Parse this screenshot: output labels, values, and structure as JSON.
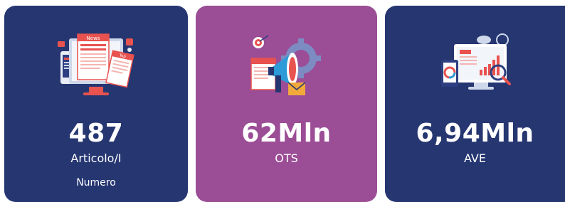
{
  "cards": [
    {
      "value": "487",
      "label": "Articolo/I",
      "sublabel": "Numero",
      "icon": "news-articles-icon"
    },
    {
      "value": "62Mln",
      "label": "OTS",
      "icon": "megaphone-marketing-icon"
    },
    {
      "value": "6,94Mln",
      "label": "AVE",
      "icon": "analytics-dashboard-icon"
    }
  ],
  "illustration_text": {
    "news": "News",
    "top": "Top"
  },
  "colors": {
    "navy": "#253671",
    "purple": "#9b4d96",
    "text": "#ffffff",
    "accent_red": "#e8524f"
  }
}
